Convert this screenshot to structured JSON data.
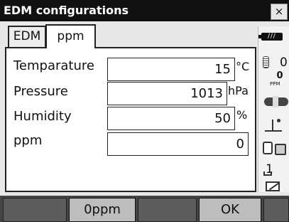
{
  "window": {
    "title": "EDM configurations",
    "close_label": "×"
  },
  "tabs": [
    {
      "label": "EDM",
      "active": false
    },
    {
      "label": "ppm",
      "active": true
    }
  ],
  "fields": [
    {
      "label": "Temparature",
      "value": "15",
      "unit": "°C"
    },
    {
      "label": "Pressure",
      "value": "1013",
      "unit": "hPa"
    },
    {
      "label": "Humidity",
      "value": "50",
      "unit": "%"
    },
    {
      "label": "ppm",
      "value": "0",
      "unit": ""
    }
  ],
  "status": {
    "prism_constant": "0",
    "ppm_value": "0",
    "ppm_label": "PPM",
    "input_mode": "1"
  },
  "softkeys": [
    {
      "label": ""
    },
    {
      "label": "0ppm"
    },
    {
      "label": ""
    },
    {
      "label": "OK"
    },
    {
      "label": ""
    }
  ]
}
